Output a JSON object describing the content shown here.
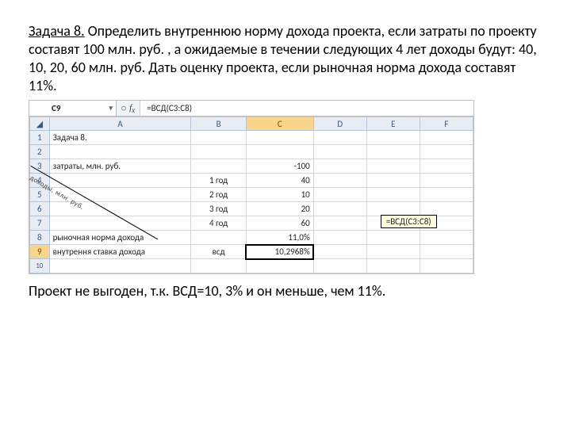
{
  "problem": {
    "title": "Задача 8.",
    "body": " Определить внутреннюю норму дохода проекта, если затраты по проекту составят  100 млн. руб. , а ожидаемые в течении следующих 4 лет доходы будут: 40, 10, 20, 60 млн. руб. Дать оценку проекта, если рыночная норма дохода составят 11%."
  },
  "formula_bar": {
    "cell_ref": "C9",
    "formula": "=ВСД(C3:C8)"
  },
  "columns": [
    "A",
    "B",
    "C",
    "D",
    "E",
    "F"
  ],
  "rows": [
    {
      "n": "1",
      "A": "Задача 8.",
      "B": "",
      "C": "",
      "D": "",
      "E": "",
      "F": ""
    },
    {
      "n": "2",
      "A": "",
      "B": "",
      "C": "",
      "D": "",
      "E": "",
      "F": ""
    },
    {
      "n": "3",
      "A": "затраты, млн. руб.",
      "B": "",
      "C": "-100",
      "D": "",
      "E": "",
      "F": ""
    },
    {
      "n": "4",
      "A": "",
      "B": "1 год",
      "C": "40",
      "D": "",
      "E": "",
      "F": ""
    },
    {
      "n": "5",
      "A": "",
      "B": "2 год",
      "C": "10",
      "D": "",
      "E": "",
      "F": ""
    },
    {
      "n": "6",
      "A": "",
      "B": "3 год",
      "C": "20",
      "D": "",
      "E": "",
      "F": ""
    },
    {
      "n": "7",
      "A": "",
      "B": "4 год",
      "C": "60",
      "D": "",
      "E": "",
      "F": ""
    },
    {
      "n": "8",
      "A": "рыночная норма дохода",
      "B": "",
      "C": "11,0%",
      "D": "",
      "E": "",
      "F": ""
    },
    {
      "n": "9",
      "A": "внутрення ставка дохода",
      "B": "всд",
      "C": "10,2968%",
      "D": "",
      "E": "",
      "F": ""
    }
  ],
  "diagonal_label": "доходы, млн. руб.",
  "tooltip": "=ВСД(C3:C8)",
  "conclusion": "Проект не выгоден, т.к. ВСД=10, 3% и он меньше, чем 11%."
}
